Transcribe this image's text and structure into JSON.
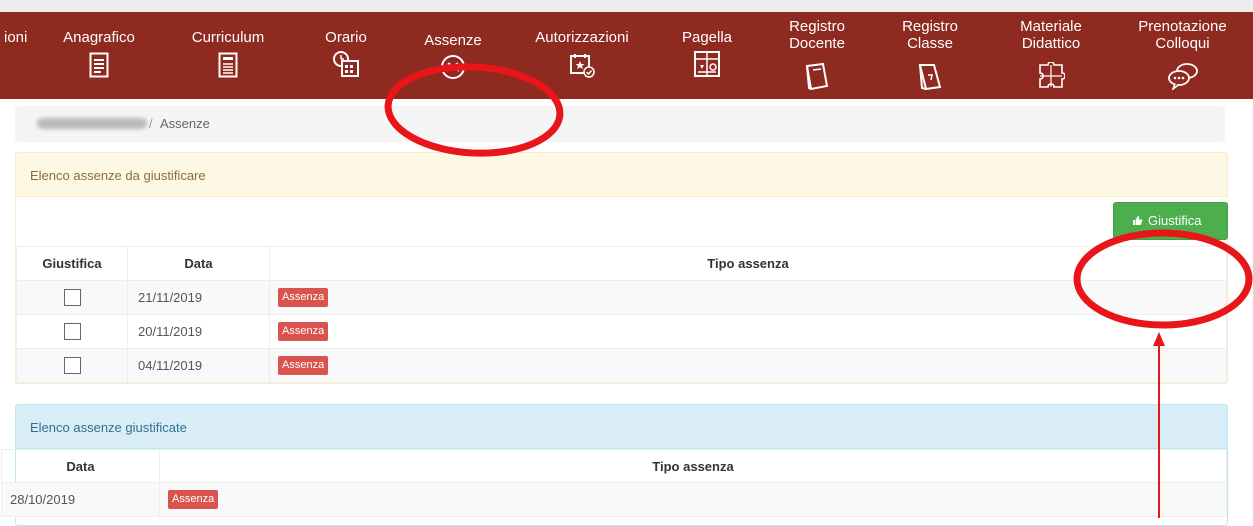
{
  "navbar": {
    "items": [
      {
        "line1": "ioni",
        "line2": ""
      },
      {
        "line1": "Anagrafico",
        "line2": ""
      },
      {
        "line1": "Curriculum",
        "line2": ""
      },
      {
        "line1": "Orario",
        "line2": ""
      },
      {
        "line1": "Assenze",
        "line2": ""
      },
      {
        "line1": "Autorizzazioni",
        "line2": ""
      },
      {
        "line1": "Pagella",
        "line2": ""
      },
      {
        "line1": "Registro",
        "line2": "Docente"
      },
      {
        "line1": "Registro",
        "line2": "Classe"
      },
      {
        "line1": "Materiale",
        "line2": "Didattico"
      },
      {
        "line1": "Prenotazione",
        "line2": "Colloqui"
      }
    ]
  },
  "breadcrumb": {
    "separator": "/",
    "current": "Assenze"
  },
  "panel_unjustified": {
    "title": "Elenco assenze da giustificare",
    "button_label": "Giustifica",
    "columns": [
      "Giustifica",
      "Data",
      "Tipo assenza"
    ],
    "rows": [
      {
        "date": "21/11/2019",
        "type": "Assenza"
      },
      {
        "date": "20/11/2019",
        "type": "Assenza"
      },
      {
        "date": "04/11/2019",
        "type": "Assenza"
      }
    ]
  },
  "panel_justified": {
    "title": "Elenco assenze giustificate",
    "columns": [
      "Data",
      "Tipo assenza"
    ],
    "rows": [
      {
        "date": "28/10/2019",
        "type": "Assenza"
      }
    ]
  },
  "colors": {
    "navbar_bg": "#8e2a1f",
    "annotation_red": "#e8151b",
    "badge_red": "#d9534f",
    "button_green": "#4cae4c",
    "warning_panel_bg": "#fcf8e3",
    "info_panel_bg": "#d9edf7"
  }
}
